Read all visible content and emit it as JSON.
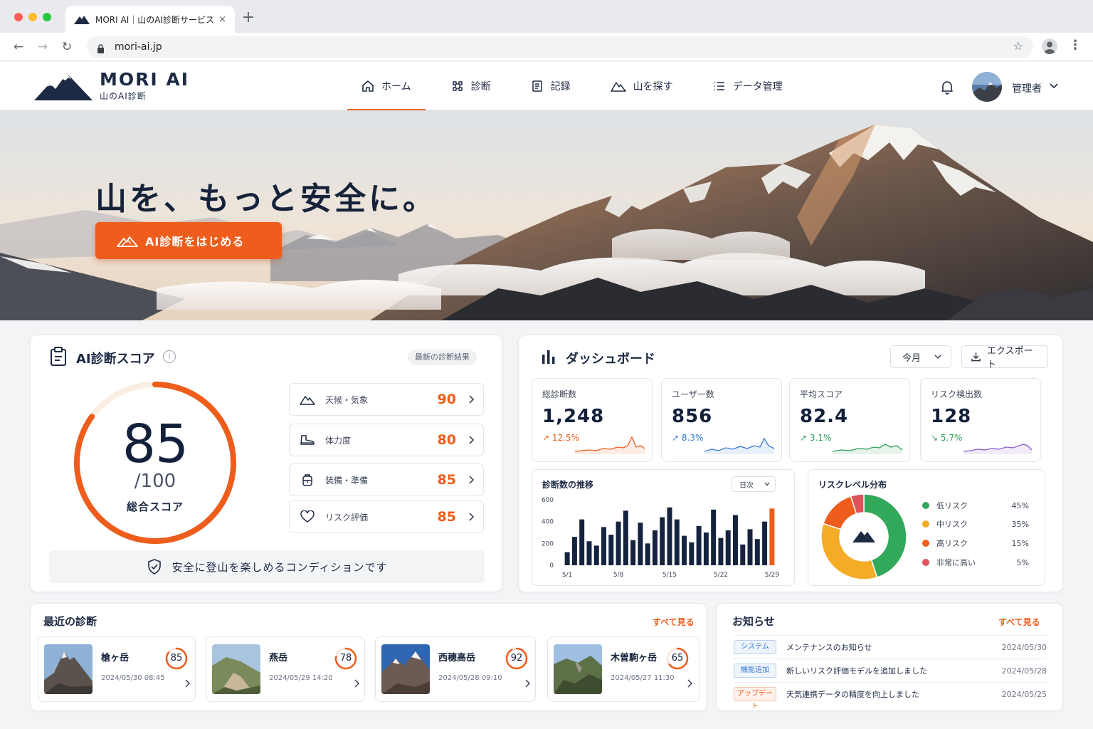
{
  "browser": {
    "tab_title": "MORI AI｜山のAI診断サービス",
    "tab_close": "×",
    "new_tab": "+",
    "url": "mori-ai.jp",
    "back": "←",
    "forward": "→",
    "reload": "↻",
    "bookmark": "☆",
    "menu": "⋮"
  },
  "header": {
    "logo_main": "MORI AI",
    "logo_sub": "山のAI診断",
    "nav": [
      {
        "label": "ホーム",
        "icon": "home-icon",
        "active": true
      },
      {
        "label": "診断",
        "icon": "diagnosis-icon"
      },
      {
        "label": "記録",
        "icon": "record-icon"
      },
      {
        "label": "山を探す",
        "icon": "mountain-icon"
      },
      {
        "label": "データ管理",
        "icon": "list-icon"
      }
    ],
    "user_name": "管理者"
  },
  "hero": {
    "title": "山を、もっと安全に。",
    "cta_label": "AI診断をはじめる"
  },
  "score_card": {
    "title": "AI診断スコア",
    "info": "i",
    "pill": "最新の診断結果",
    "score": "85",
    "denominator": "/100",
    "score_label": "総合スコア",
    "score_fraction": 0.85,
    "metrics": [
      {
        "label": "天候・気象",
        "value": "90",
        "icon": "weather-mountain-icon"
      },
      {
        "label": "体力度",
        "value": "80",
        "icon": "boot-icon"
      },
      {
        "label": "装備・準備",
        "value": "85",
        "icon": "backpack-icon"
      },
      {
        "label": "リスク評価",
        "value": "85",
        "icon": "heart-icon"
      }
    ],
    "condition": "安全に登山を楽しめるコンディションです"
  },
  "dashboard": {
    "title": "ダッシュボード",
    "period": "今月",
    "export": "エクスポート",
    "stats": [
      {
        "label": "総診断数",
        "value": "1,248",
        "change": "↗ 12.5%",
        "color": "#ee5d1c"
      },
      {
        "label": "ユーザー数",
        "value": "856",
        "change": "↗ 8.3%",
        "color": "#3a7bd5"
      },
      {
        "label": "平均スコア",
        "value": "82.4",
        "change": "↗ 3.1%",
        "color": "#2f9e5b"
      },
      {
        "label": "リスク検出数",
        "value": "128",
        "change": "↘ 5.7%",
        "color": "#8a5cc9"
      }
    ],
    "trend": {
      "title": "診断数の推移",
      "granularity": "日次"
    },
    "risk": {
      "title": "リスクレベル分布"
    }
  },
  "chart_data": [
    {
      "type": "bar",
      "title": "診断数の推移",
      "x_ticks": [
        "5/1",
        "5/8",
        "5/15",
        "5/22",
        "5/29"
      ],
      "y_ticks": [
        "600",
        "400",
        "200",
        "0"
      ],
      "ylim": [
        0,
        600
      ],
      "values": [
        120,
        260,
        420,
        220,
        180,
        350,
        280,
        400,
        500,
        230,
        390,
        200,
        320,
        440,
        530,
        420,
        270,
        210,
        360,
        300,
        510,
        250,
        320,
        460,
        190,
        330,
        240,
        400,
        520
      ],
      "highlight_last": 520,
      "colors": {
        "bar": "#15233f",
        "highlight": "#ee5d1c"
      }
    },
    {
      "type": "pie",
      "title": "リスクレベル分布",
      "categories": [
        "低リスク",
        "中リスク",
        "高リスク",
        "非常に高い"
      ],
      "values": [
        45,
        35,
        15,
        5
      ],
      "labels": [
        "45%",
        "35%",
        "15%",
        "5%"
      ],
      "colors": [
        "#32a85a",
        "#f4ab26",
        "#ee5d1c",
        "#e0525a"
      ]
    }
  ],
  "recent": {
    "title": "最近の診断",
    "see_all": "すべて見る",
    "items": [
      {
        "name": "槍ヶ岳",
        "date": "2024/05/30 08:45",
        "score": "85",
        "fraction": 0.85
      },
      {
        "name": "燕岳",
        "date": "2024/05/29 14:20",
        "score": "78",
        "fraction": 0.78
      },
      {
        "name": "西穂高岳",
        "date": "2024/05/28 09:10",
        "score": "92",
        "fraction": 0.92
      },
      {
        "name": "木曽駒ヶ岳",
        "date": "2024/05/27 11:30",
        "score": "65",
        "fraction": 0.65
      }
    ]
  },
  "news": {
    "title": "お知らせ",
    "see_all": "すべて見る",
    "items": [
      {
        "tag": "システム",
        "text": "メンテナンスのお知らせ",
        "date": "2024/05/30",
        "tag_color": "#3a7bd5"
      },
      {
        "tag": "機能追加",
        "text": "新しいリスク評価モデルを追加しました",
        "date": "2024/05/28",
        "tag_color": "#3a7bd5"
      },
      {
        "tag": "アップデート",
        "text": "天気連携データの精度を向上しました",
        "date": "2024/05/25",
        "tag_color": "#ee5d1c"
      }
    ]
  }
}
